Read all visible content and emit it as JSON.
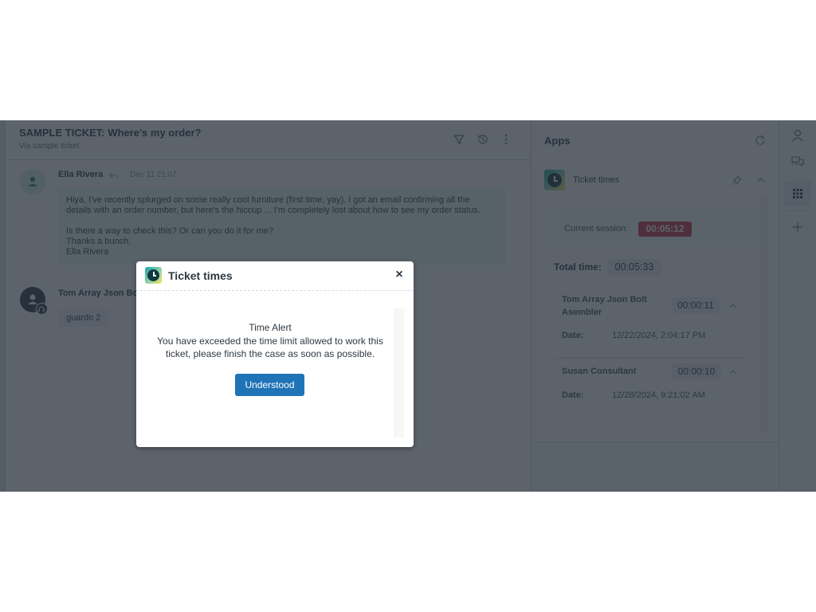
{
  "ticket": {
    "title": "SAMPLE TICKET: Where's my order?",
    "subtitle": "Via sample ticket",
    "header_icons": [
      "filter-icon",
      "history-icon",
      "more-options-icon"
    ]
  },
  "messages": [
    {
      "author": "Ella Rivera",
      "meta_icon": "reply-icon",
      "separator": "·",
      "timestamp": "Dec 11 21:07",
      "paragraphs": [
        "Hiya, I've recently splurged on some really cool furniture (first time, yay). I got an email confirming all the details with an order number, but here's the hiccup ... I'm completely lost about how to see my order status.",
        "Is there a way to check this? Or can you do it for me?\nThanks a bunch,\nElla Rivera"
      ]
    },
    {
      "author": "Tom Array Json Bolt Asembler",
      "body": "guardo 2"
    }
  ],
  "apps_panel": {
    "title": "Apps",
    "app": {
      "name": "Ticket times",
      "current_session_label": "Current session:",
      "current_session": "00:05:12",
      "total_time_label": "Total time:",
      "total_time": "00:05:33",
      "agents": [
        {
          "name": "Tom Array Json Bolt Asembler",
          "time": "00:00:11",
          "date_label": "Date:",
          "date": "12/22/2024, 2:04:17 PM"
        },
        {
          "name": "Susan Consultant",
          "time": "00:00:10",
          "date_label": "Date:",
          "date": "12/28/2024, 9:21:02 AM"
        }
      ]
    }
  },
  "rail": {
    "icons": [
      "user-icon",
      "conversations-icon",
      "apps-grid-icon",
      "add-icon"
    ],
    "active": "apps-grid-icon"
  },
  "modal": {
    "title": "Ticket times",
    "close_label": "×",
    "alert_title": "Time Alert",
    "alert_text": "You have exceeded the time limit allowed to work this ticket, please finish the case as soon as possible.",
    "button_label": "Understood"
  },
  "colors": {
    "primary": "#1f73b7",
    "danger": "#cc3340",
    "overlay": "#262f3a"
  }
}
